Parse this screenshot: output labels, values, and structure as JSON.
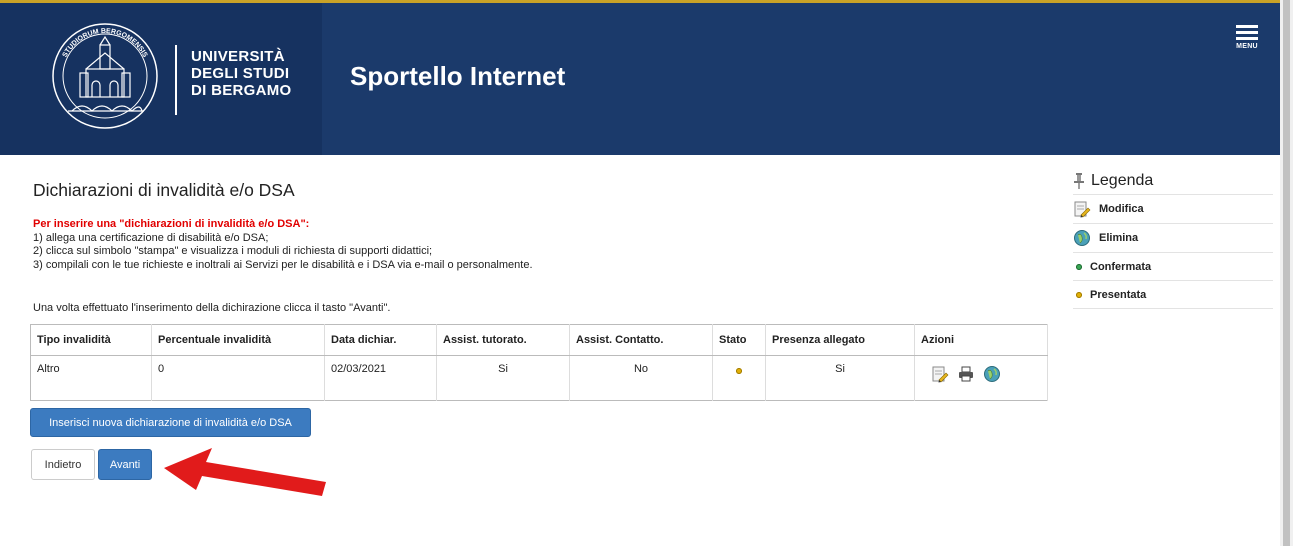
{
  "header": {
    "university_lines": [
      "UNIVERSITÀ",
      "DEGLI STUDI",
      "DI BERGAMO"
    ],
    "seal_text": "STUDIORUM BERGOMENSIS",
    "app_title": "Sportello Internet",
    "menu_label": "MENU",
    "header_color": "#1b3a6b",
    "accent_line": "#c9a227"
  },
  "page": {
    "title": "Dichiarazioni di invalidità e/o DSA",
    "instructions_heading": "Per inserire una \"dichiarazioni di invalidità e/o DSA\":",
    "instructions": [
      "1) allega una certificazione di disabilità e/o DSA;",
      "2) clicca sul simbolo \"stampa\" e visualizza i moduli di richiesta di supporti didattici;",
      "3) compilali con le tue richieste e inoltrali ai Servizi per le disabilità e i DSA via e-mail o personalmente."
    ],
    "note": "Una volta effettuato l'inserimento della dichirazione clicca il tasto \"Avanti\"."
  },
  "table": {
    "columns": [
      "Tipo invalidità",
      "Percentuale invalidità",
      "Data dichiar.",
      "Assist. tutorato.",
      "Assist. Contatto.",
      "Stato",
      "Presenza allegato",
      "Azioni"
    ],
    "rows": [
      {
        "tipo": "Altro",
        "percentuale": "0",
        "data": "02/03/2021",
        "assist_tutorato": "Si",
        "assist_contatto": "No",
        "stato_icon": "yellow-dot-icon",
        "presenza_allegato": "Si",
        "azioni": [
          "edit-icon",
          "print-icon",
          "delete-globe-icon"
        ]
      }
    ]
  },
  "buttons": {
    "new_declaration": "Inserisci nuova dichiarazione di invalidità e/o DSA",
    "back": "Indietro",
    "next": "Avanti",
    "primary_color": "#3c7bc0"
  },
  "legend": {
    "title": "Legenda",
    "items": [
      {
        "label": "Modifica",
        "icon": "edit-icon"
      },
      {
        "label": "Elimina",
        "icon": "delete-globe-icon"
      },
      {
        "label": "Confermata",
        "icon": "green-dot-icon",
        "color": "#3aa655"
      },
      {
        "label": "Presentata",
        "icon": "yellow-dot-icon",
        "color": "#e2b007"
      }
    ]
  },
  "annotation": {
    "arrow_color": "#e11b1b",
    "arrow_icon": "red-arrow-icon"
  }
}
